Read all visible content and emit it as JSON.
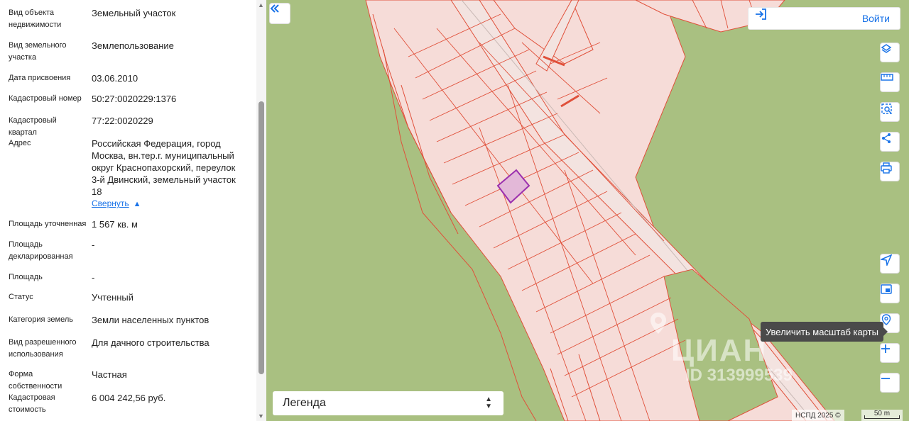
{
  "panel": {
    "fields": [
      {
        "label": "Вид объекта недвижимости",
        "value": "Земельный участок"
      },
      {
        "label": "Вид земельного участка",
        "value": "Землепользование"
      },
      {
        "label": "Дата присвоения",
        "value": "03.06.2010"
      },
      {
        "label": "Кадастровый номер",
        "value": "50:27:0020229:1376"
      },
      {
        "label": "Кадастровый квартал",
        "value": "77:22:0020229"
      },
      {
        "label": "Адрес",
        "value": "Российская Федерация, город Москва, вн.тер.г. муниципальный округ Краснопахорский, переулок 3-й Двинский, земельный участок 18"
      },
      {
        "label": "Площадь уточненная",
        "value": "1 567 кв. м"
      },
      {
        "label": "Площадь декларированная",
        "value": "-"
      },
      {
        "label": "Площадь",
        "value": "-"
      },
      {
        "label": "Статус",
        "value": "Учтенный"
      },
      {
        "label": "Категория земель",
        "value": "Земли населенных пунктов"
      },
      {
        "label": "Вид разрешенного использования",
        "value": "Для дачного строительства"
      },
      {
        "label": "Форма собственности",
        "value": "Частная"
      },
      {
        "label": "Кадастровая стоимость",
        "value": "6 004 242,56 руб."
      }
    ],
    "collapse_link": "Свернуть"
  },
  "map": {
    "login_label": "Войти",
    "tooltip": "Увеличить масштаб карты",
    "legend_label": "Легенда",
    "copyright": "НСПД 2025 ©",
    "scale_label": "50 m",
    "watermark_brand": "ЦИАН",
    "watermark_id": "ID 313999539",
    "colors": {
      "ground": "#a9c081",
      "parcel_fill": "#f6dcd8",
      "parcel_line": "#e0503a",
      "selected": "#9b2fae"
    }
  }
}
